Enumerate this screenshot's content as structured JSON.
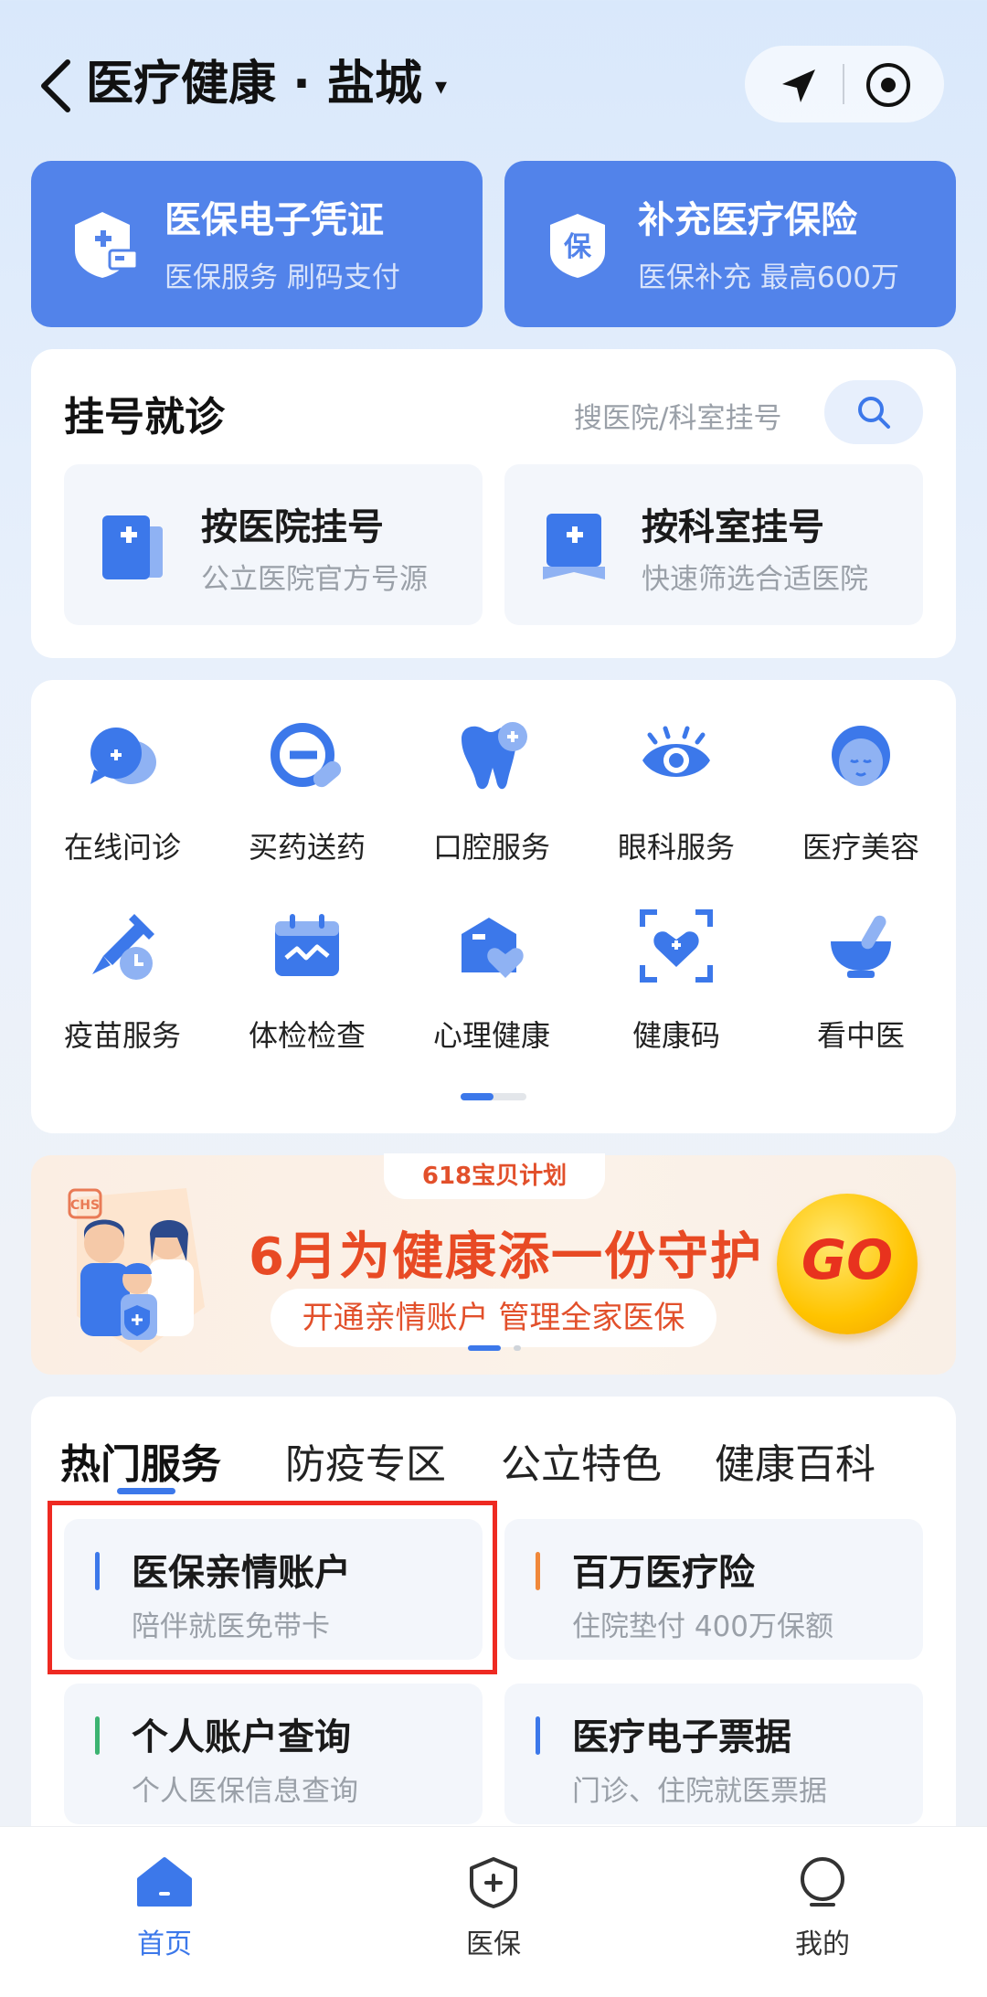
{
  "header": {
    "title": "医疗健康 · 盐城",
    "dropdown_glyph": "▾"
  },
  "top_cards": [
    {
      "title": "医保电子凭证",
      "subtitle": "医保服务 刷码支付",
      "icon": "insurance-card-icon"
    },
    {
      "title": "补充医疗保险",
      "subtitle": "医保补充 最高600万",
      "icon": "shield-bao-icon",
      "icon_text": "保"
    }
  ],
  "register": {
    "title": "挂号就诊",
    "search_hint": "搜医院/科室挂号",
    "options": [
      {
        "title": "按医院挂号",
        "subtitle": "公立医院官方号源",
        "icon": "hospital-icon"
      },
      {
        "title": "按科室挂号",
        "subtitle": "快速筛选合适医院",
        "icon": "department-icon"
      }
    ]
  },
  "services_grid": [
    {
      "label": "在线问诊",
      "icon": "chat-consult-icon"
    },
    {
      "label": "买药送药",
      "icon": "medicine-delivery-icon"
    },
    {
      "label": "口腔服务",
      "icon": "tooth-icon"
    },
    {
      "label": "眼科服务",
      "icon": "eye-icon"
    },
    {
      "label": "医疗美容",
      "icon": "beauty-face-icon"
    },
    {
      "label": "疫苗服务",
      "icon": "vaccine-icon"
    },
    {
      "label": "体检检查",
      "icon": "calendar-checkup-icon"
    },
    {
      "label": "心理健康",
      "icon": "heart-box-icon"
    },
    {
      "label": "健康码",
      "icon": "health-code-icon"
    },
    {
      "label": "看中医",
      "icon": "mortar-pestle-icon"
    }
  ],
  "banner": {
    "tag": "618宝贝计划",
    "headline": "6月为健康添一份守护",
    "sub": "开通亲情账户 管理全家医保",
    "cta": "GO",
    "badge_text": "CHS"
  },
  "hot": {
    "tabs": [
      "热门服务",
      "防疫专区",
      "公立特色",
      "健康百科"
    ],
    "active_tab": 0,
    "items": [
      {
        "title": "医保亲情账户",
        "subtitle": "陪伴就医免带卡",
        "accent": "#3c78ea"
      },
      {
        "title": "百万医疗险",
        "subtitle": "住院垫付 400万保额",
        "accent": "#f0883a"
      },
      {
        "title": "个人账户查询",
        "subtitle": "个人医保信息查询",
        "accent": "#3cb371"
      },
      {
        "title": "医疗电子票据",
        "subtitle": "门诊、住院就医票据",
        "accent": "#3c78ea"
      }
    ]
  },
  "tabbar": [
    {
      "label": "首页",
      "icon": "home-icon",
      "active": true
    },
    {
      "label": "医保",
      "icon": "shield-plus-icon",
      "active": false
    },
    {
      "label": "我的",
      "icon": "person-icon",
      "active": false
    }
  ],
  "colors": {
    "primary": "#3c78ea",
    "card_blue": "#5283ea",
    "highlight": "#ee2a22",
    "banner_red": "#e84a24"
  }
}
